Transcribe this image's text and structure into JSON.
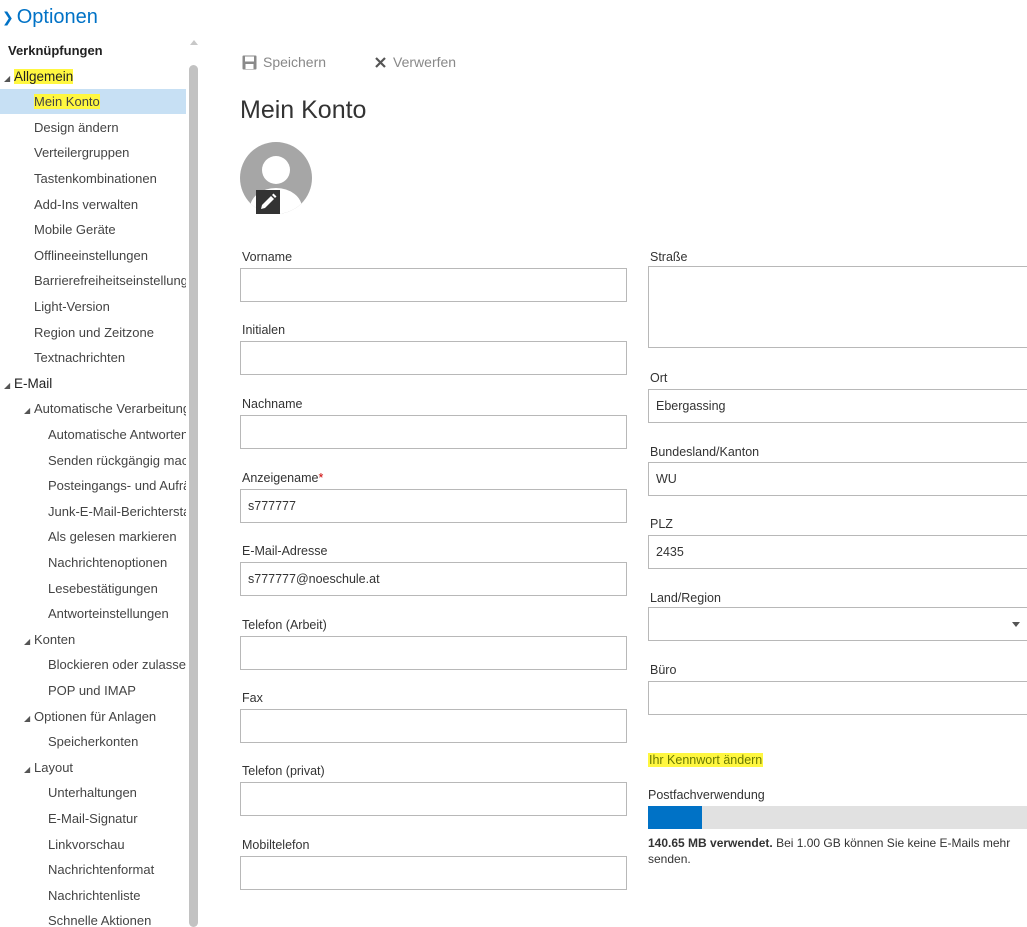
{
  "app": {
    "title": "Optionen"
  },
  "sidebar": {
    "items": [
      {
        "label": "Verknüpfungen",
        "level": 0,
        "type": "head"
      },
      {
        "label": "Allgemein",
        "level": 0,
        "type": "cat",
        "expanded": true,
        "highlight": true
      },
      {
        "label": "Mein Konto",
        "level": 1,
        "selected": true,
        "highlight": true
      },
      {
        "label": "Design ändern",
        "level": 1
      },
      {
        "label": "Verteilergruppen",
        "level": 1
      },
      {
        "label": "Tastenkombinationen",
        "level": 1
      },
      {
        "label": "Add-Ins verwalten",
        "level": 1
      },
      {
        "label": "Mobile Geräte",
        "level": 1
      },
      {
        "label": "Offlineeinstellungen",
        "level": 1
      },
      {
        "label": "Barrierefreiheitseinstellungen",
        "level": 1
      },
      {
        "label": "Light-Version",
        "level": 1
      },
      {
        "label": "Region und Zeitzone",
        "level": 1
      },
      {
        "label": "Textnachrichten",
        "level": 1
      },
      {
        "label": "E-Mail",
        "level": 0,
        "type": "cat",
        "expanded": true
      },
      {
        "label": "Automatische Verarbeitung",
        "level": 1,
        "expanded": true
      },
      {
        "label": "Automatische Antworten",
        "level": 2
      },
      {
        "label": "Senden rückgängig machen",
        "level": 2
      },
      {
        "label": "Posteingangs- und Aufräumregeln",
        "level": 2
      },
      {
        "label": "Junk-E-Mail-Berichterstattung",
        "level": 2
      },
      {
        "label": "Als gelesen markieren",
        "level": 2
      },
      {
        "label": "Nachrichtenoptionen",
        "level": 2
      },
      {
        "label": "Lesebestätigungen",
        "level": 2
      },
      {
        "label": "Antworteinstellungen",
        "level": 2
      },
      {
        "label": "Konten",
        "level": 1,
        "expanded": true
      },
      {
        "label": "Blockieren oder zulassen",
        "level": 2
      },
      {
        "label": "POP und IMAP",
        "level": 2
      },
      {
        "label": "Optionen für Anlagen",
        "level": 1,
        "expanded": true
      },
      {
        "label": "Speicherkonten",
        "level": 2
      },
      {
        "label": "Layout",
        "level": 1,
        "expanded": true
      },
      {
        "label": "Unterhaltungen",
        "level": 2
      },
      {
        "label": "E-Mail-Signatur",
        "level": 2
      },
      {
        "label": "Linkvorschau",
        "level": 2
      },
      {
        "label": "Nachrichtenformat",
        "level": 2
      },
      {
        "label": "Nachrichtenliste",
        "level": 2
      },
      {
        "label": "Schnelle Aktionen",
        "level": 2
      }
    ]
  },
  "toolbar": {
    "save_label": "Speichern",
    "discard_label": "Verwerfen",
    "save_icon": "floppy-disk-icon",
    "discard_icon": "x-icon"
  },
  "main": {
    "title": "Mein Konto",
    "left_fields": [
      {
        "label": "Vorname",
        "value": "",
        "name": "first-name"
      },
      {
        "label": "Initialen",
        "value": "",
        "name": "initials"
      },
      {
        "label": "Nachname",
        "value": "",
        "name": "last-name"
      },
      {
        "label": "Anzeigename",
        "value": "s777777",
        "name": "display-name",
        "required": true,
        "required_mark": "*"
      },
      {
        "label": "E-Mail-Adresse",
        "value": "s777777@noeschule.at",
        "name": "email-address"
      },
      {
        "label": "Telefon (Arbeit)",
        "value": "",
        "name": "work-phone"
      },
      {
        "label": "Fax",
        "value": "",
        "name": "fax"
      },
      {
        "label": "Telefon (privat)",
        "value": "",
        "name": "home-phone"
      },
      {
        "label": "Mobiltelefon",
        "value": "",
        "name": "mobile-phone"
      }
    ],
    "right_fields": {
      "street": {
        "label": "Straße",
        "value": ""
      },
      "city": {
        "label": "Ort",
        "value": "Ebergassing"
      },
      "state": {
        "label": "Bundesland/Kanton",
        "value": "WU"
      },
      "zip": {
        "label": "PLZ",
        "value": "2435"
      },
      "country": {
        "label": "Land/Region",
        "value": ""
      },
      "office": {
        "label": "Büro",
        "value": ""
      }
    },
    "password_link": "Ihr Kennwort ändern",
    "mailbox": {
      "label": "Postfachverwendung",
      "usage_fraction": 0.14,
      "used_text": "140.65 MB verwendet.",
      "limit_text": " Bei 1.00 GB können Sie keine E-Mails mehr senden."
    }
  },
  "colors": {
    "accent": "#0072c6",
    "highlight": "#fff740",
    "selected": "#c7e0f4"
  }
}
